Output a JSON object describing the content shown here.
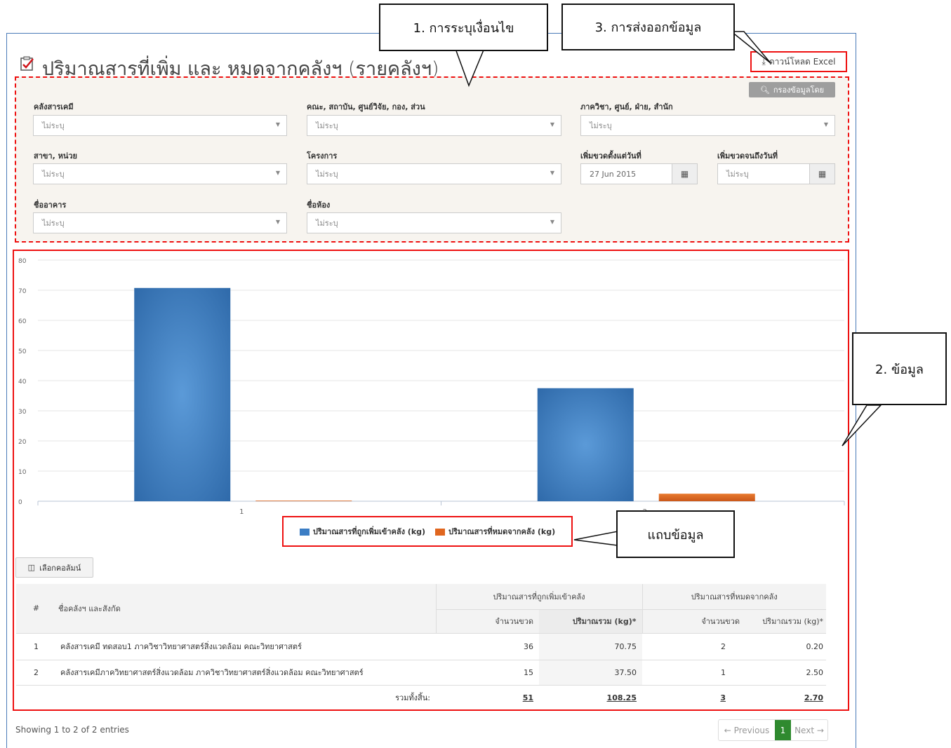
{
  "page": {
    "title": "ปริมาณสารที่เพิ่ม และ หมดจากคลังฯ (รายคลังฯ)",
    "download_label": "ดาวน์โหลด Excel",
    "filter_button_label": "กรองข้อมูลโดย"
  },
  "callouts": {
    "criteria": "1. การระบุเงื่อนไข",
    "export": "3. การส่งออกข้อมูล",
    "data": "2. ข้อมูล",
    "legend": "แถบข้อมูล"
  },
  "filters": {
    "warehouse": {
      "label": "คลังสารเคมี",
      "value": "ไม่ระบุ"
    },
    "faculty": {
      "label": "คณะ, สถาบัน, ศูนย์วิจัย, กอง, ส่วน",
      "value": "ไม่ระบุ"
    },
    "department": {
      "label": "ภาควิชา, ศูนย์, ฝ่าย, สำนัก",
      "value": "ไม่ระบุ"
    },
    "branch": {
      "label": "สาขา, หน่วย",
      "value": "ไม่ระบุ"
    },
    "project": {
      "label": "โครงการ",
      "value": "ไม่ระบุ"
    },
    "date_from": {
      "label": "เพิ่มขวดตั้งแต่วันที่",
      "value": "27 Jun 2015"
    },
    "date_to": {
      "label": "เพิ่มขวดจนถึงวันที่",
      "value": "ไม่ระบุ"
    },
    "building": {
      "label": "ชื่ออาคาร",
      "value": "ไม่ระบุ"
    },
    "room": {
      "label": "ชื่อห้อง",
      "value": "ไม่ระบุ"
    }
  },
  "colors": {
    "bar_added": "#3b7dc4",
    "bar_removed": "#e0661f",
    "annotation_red": "#ee1111"
  },
  "chart_data": {
    "type": "bar",
    "categories": [
      "1",
      "2"
    ],
    "series": [
      {
        "name": "ปริมาณสารที่ถูกเพิ่มเข้าคลัง (kg)",
        "values": [
          70.75,
          37.5
        ]
      },
      {
        "name": "ปริมาณสารที่หมดจากคลัง (kg)",
        "values": [
          0.2,
          2.5
        ]
      }
    ],
    "ylim": [
      0,
      80
    ],
    "yticks": [
      "0",
      "10",
      "20",
      "30",
      "40",
      "50",
      "60",
      "70",
      "80"
    ],
    "grid": true,
    "legend": "bottom"
  },
  "table": {
    "columns_button": "เลือกคอลัมน์",
    "headers": {
      "num": "#",
      "name": "ชื่อคลังฯ และสังกัด",
      "group_added": "ปริมาณสารที่ถูกเพิ่มเข้าคลัง",
      "group_removed": "ปริมาณสารที่หมดจากคลัง",
      "bottles_added": "จำนวนขวด",
      "qty_added": "ปริมาณรวม (kg)*",
      "bottles_removed": "จำนวนขวด",
      "qty_removed": "ปริมาณรวม (kg)*"
    },
    "rows": [
      {
        "num": "1",
        "name": "คลังสารเคมี ทดสอบ1 ภาควิชาวิทยาศาสตร์สิ่งแวดล้อม คณะวิทยาศาสตร์",
        "bottles_added": "36",
        "qty_added": "70.75",
        "bottles_removed": "2",
        "qty_removed": "0.20"
      },
      {
        "num": "2",
        "name": "คลังสารเคมีภาควิทยาศาสตร์สิ่งแวดล้อม ภาควิชาวิทยาศาสตร์สิ่งแวดล้อม คณะวิทยาศาสตร์",
        "bottles_added": "15",
        "qty_added": "37.50",
        "bottles_removed": "1",
        "qty_removed": "2.50"
      }
    ],
    "total": {
      "label": "รวมทั้งสิ้น:",
      "bottles_added": "51",
      "qty_added": "108.25",
      "bottles_removed": "3",
      "qty_removed": "2.70"
    }
  },
  "footer": {
    "showing": "Showing 1 to 2 of 2 entries",
    "previous": "← Previous",
    "page": "1",
    "next": "Next →"
  }
}
